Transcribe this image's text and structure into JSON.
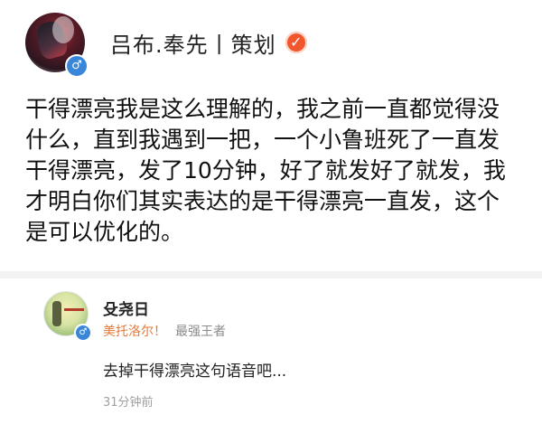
{
  "post": {
    "author": {
      "name": "吕布.奉先丨策划",
      "gender_icon": "male-icon",
      "verified_icon": "verified-badge-icon"
    },
    "text": "干得漂亮我是这么理解的，我之前一直都觉得没什么，直到我遇到一把，一个小鲁班死了一直发干得漂亮，发了10分钟，好了就发好了就发，我才明白你们其实表达的是干得漂亮一直发，这个是可以优化的。"
  },
  "comment": {
    "author": {
      "name": "殳尧日",
      "gender_icon": "male-icon"
    },
    "subtitle_a": "美托洛尔！",
    "subtitle_b": "最强王者",
    "text": "去掉干得漂亮这句语音吧...",
    "time": "31分钟前"
  },
  "colors": {
    "verified": "#f2562d",
    "gender": "#3a86d8",
    "subtitle_accent": "#e07a3a",
    "muted": "#a0a0a0"
  }
}
